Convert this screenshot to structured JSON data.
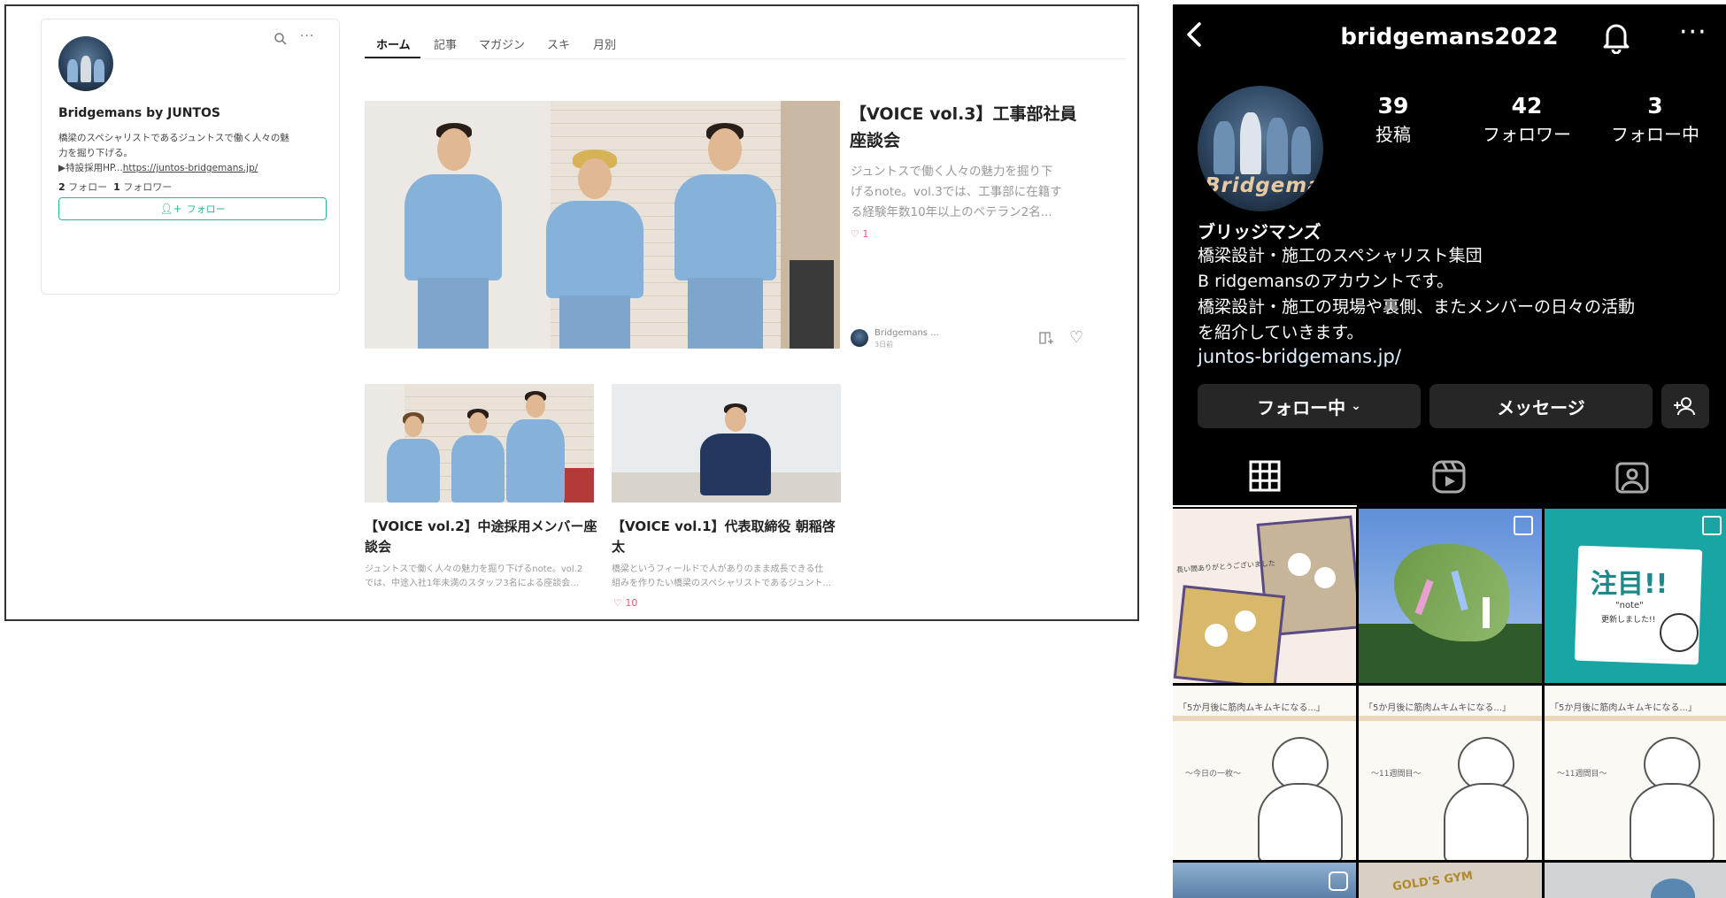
{
  "note": {
    "profile": {
      "name": "Bridgemans by JUNTOS",
      "bio_line1": "橋梁のスペシャリストであるジュントスで働く人々の魅",
      "bio_line2": "力を掘り下げる。",
      "bio_prefix": "▶特設採用HP...",
      "bio_link": "https://juntos-bridgemans.jp/",
      "follow_count": "2",
      "follow_label": "フォロー",
      "follower_count": "1",
      "follower_label": "フォロワー",
      "follow_button": "フォロー"
    },
    "tabs": [
      {
        "label": "ホーム"
      },
      {
        "label": "記事"
      },
      {
        "label": "マガジン"
      },
      {
        "label": "スキ"
      },
      {
        "label": "月別"
      }
    ],
    "featured": {
      "title_line1": "【VOICE vol.3】工事部社員",
      "title_line2": "座談会",
      "excerpt_line1": "ジュントスで働く人々の魅力を掘り下",
      "excerpt_line2": "げるnote。vol.3では、工事部に在籍す",
      "excerpt_line3": "る経験年数10年以上のベテラン2名...",
      "likes": "1",
      "author": "Bridgemans ...",
      "date": "3日前"
    },
    "articles": [
      {
        "title_line1": "【VOICE vol.2】中途採用メンバー座",
        "title_line2": "談会",
        "excerpt_line1": "ジュントスで働く人々の魅力を掘り下げるnote。vol.2",
        "excerpt_line2": "では、中途入社1年未満のスタッフ3名による座談会..."
      },
      {
        "title_line1": "【VOICE vol.1】代表取締役 朝稲啓",
        "title_line2": "太",
        "excerpt_line1": "橋梁というフィールドで人がありのまま成長できる仕",
        "excerpt_line2": "組みを作りたい橋梁のスペシャリストであるジュント...",
        "likes": "10"
      }
    ]
  },
  "instagram": {
    "username": "bridgemans2022",
    "avatar_text": "Bridgeman",
    "stats": [
      {
        "count": "39",
        "label": "投稿"
      },
      {
        "count": "42",
        "label": "フォロワー"
      },
      {
        "count": "3",
        "label": "フォロー中"
      }
    ],
    "display_name": "ブリッジマンズ",
    "bio_line1": "橋梁設計・施工のスペシャリスト集団",
    "bio_line2": "B ridgemansのアカウントです。",
    "bio_line3": "橋梁設計・施工の現場や裏側、またメンバーの日々の活動",
    "bio_line4": "を紹介していきます。",
    "link": "juntos-bridgemans.jp/",
    "following_button": "フォロー中",
    "message_button": "メッセージ",
    "grid": {
      "post1_caption": "長い間ありがとうございました",
      "post3_title": "注目!!",
      "post3_sub": "\"note\"",
      "post3_sub2": "更新しました!!",
      "cartoon_header": "「5か月後に筋肉ムキムキになる...」",
      "cartoon1_sub": "〜今日の一枚〜",
      "cartoon2_sub": "〜11週間目〜",
      "cartoon3_sub": "〜11週間目〜",
      "gym_sign": "GOLD'S GYM"
    }
  }
}
